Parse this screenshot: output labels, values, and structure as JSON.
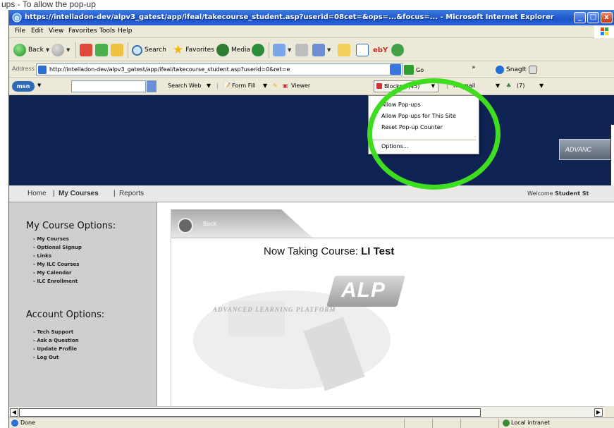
{
  "caption": "ups - To allow the pop-up",
  "window": {
    "title": "https://intelladon-dev/alpv3_gatest/app/ifeal/takecourse_student.asp?userid=08cet=&ops=...&focus=... - Microsoft Internet Explorer"
  },
  "menu": [
    "File",
    "Edit",
    "View",
    "Favorites",
    "Tools",
    "Help"
  ],
  "toolbar": {
    "back": "Back",
    "search": "Search",
    "favorites": "Favorites",
    "media": "Media"
  },
  "address": {
    "label": "Address",
    "url": "http://intelladon-dev/alpv3_gatest/app/ifeal/takecourse_student.asp?userid=0&ret=e",
    "go": "Go",
    "snagit": "SnagIt"
  },
  "msn": {
    "logo": "msn",
    "search_web": "Search Web",
    "form_fill": "Form Fill",
    "viewer": "Viewer",
    "blocked": "Blocked (45)",
    "hotmail": "Hotmail",
    "count": "(7)"
  },
  "popup_menu": {
    "items": [
      "Allow Pop-ups",
      "Allow Pop-ups for This Site",
      "Reset Pop-up Counter"
    ],
    "options": "Options..."
  },
  "site": {
    "advance_label": "ADVANC",
    "nav": {
      "home": "Home",
      "my_courses": "My Courses",
      "reports": "Reports",
      "sep": "|"
    },
    "welcome_prefix": "Welcome",
    "welcome_name": "Student St",
    "course_options_title": "My Course Options:",
    "course_links": [
      "My Courses",
      "Optional Signup",
      "Links",
      "My ILC Courses",
      "My Calendar",
      "ILC Enrollment"
    ],
    "account_options_title": "Account Options:",
    "account_links": [
      "Tech Support",
      "Ask a Question",
      "Update Profile",
      "Log Out"
    ],
    "back_tab": "Back",
    "course_prefix": "Now Taking Course:",
    "course_name": "LI Test",
    "logo_text": "ALP",
    "logo_sub": "ADVANCED LEARNING PLATFORM"
  },
  "status": {
    "text": "Done",
    "zone": "Local intranet"
  },
  "colors": {
    "titlebar": "#1d54c9",
    "banner": "#0e2353",
    "highlight_circle": "#3fdd1f",
    "sidebar": "#cfcfcf"
  }
}
